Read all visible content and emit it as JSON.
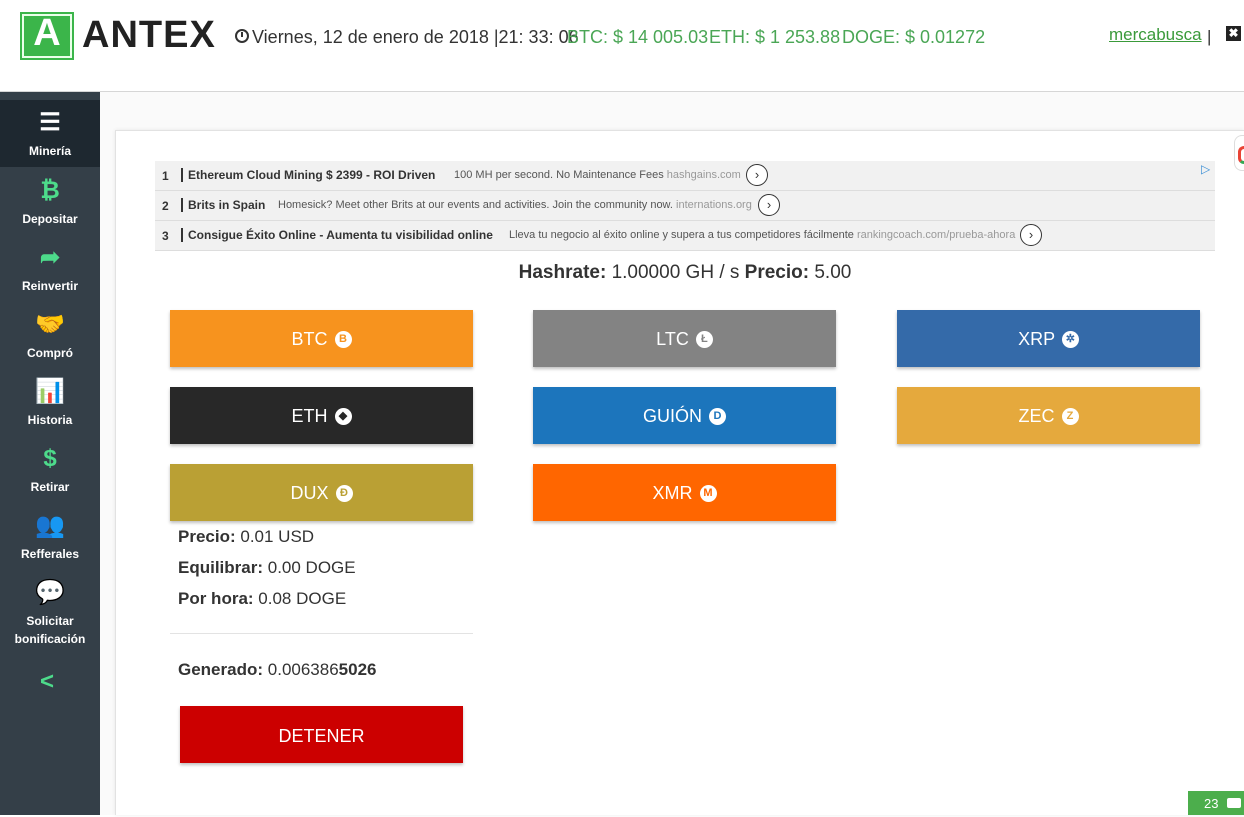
{
  "header": {
    "logo_letter": "A",
    "logo_text": "ANTEX",
    "datetime": "Viernes, 12 de enero de 2018 |21: 33: 06",
    "tickers": [
      {
        "label": "BTC: $ 14 005.03"
      },
      {
        "label": "ETH: $ 1 253.88"
      },
      {
        "label": "DOGE: $ 0.01272"
      }
    ],
    "username": "mercabusca",
    "separator": "|",
    "exit_glyph": "✖"
  },
  "sidebar": {
    "items": [
      {
        "label": "Minería",
        "icon": "list-icon",
        "glyph": "☰"
      },
      {
        "label": "Depositar",
        "icon": "bitcoin-icon",
        "glyph": "₿"
      },
      {
        "label": "Reinvertir",
        "icon": "share-arrow-icon",
        "glyph": "➦"
      },
      {
        "label": "Compró",
        "icon": "handshake-icon",
        "glyph": "🤝"
      },
      {
        "label": "Historia",
        "icon": "bar-chart-icon",
        "glyph": "📊"
      },
      {
        "label": "Retirar",
        "icon": "dollar-icon",
        "glyph": "$"
      },
      {
        "label": "Refferales",
        "icon": "users-icon",
        "glyph": "👥"
      },
      {
        "label": "Solicitar bonificación",
        "icon": "chat-icon",
        "glyph": "💬"
      }
    ],
    "collapse_glyph": "<"
  },
  "ads": {
    "rows": [
      {
        "num": "1",
        "title": "Ethereum Cloud Mining $ 2399 - ROI Driven",
        "desc": "100 MH per second. No Maintenance Fees",
        "domain": "hashgains.com",
        "go": "›"
      },
      {
        "num": "2",
        "title": "Brits in Spain",
        "desc": "Homesick? Meet other Brits at our events and activities. Join the community now.",
        "domain": "internations.org",
        "go": "›"
      },
      {
        "num": "3",
        "title": "Consigue Éxito Online - Aumenta tu visibilidad online",
        "desc": "Lleva tu negocio al éxito online y supera a tus competidores fácilmente",
        "domain": "rankingcoach.com/prueba-ahora",
        "go": "›"
      }
    ],
    "adchoice_glyph": "▷"
  },
  "mining": {
    "hashrate_label": "Hashrate:",
    "hashrate_value": "1.00000 GH / s",
    "price_label": "Precio:",
    "price_value": "5.00"
  },
  "coins": [
    {
      "label": "BTC",
      "glyph": "B",
      "color": "#f7931e"
    },
    {
      "label": "LTC",
      "glyph": "Ł",
      "color": "#838383"
    },
    {
      "label": "XRP",
      "glyph": "✲",
      "color": "#346aa9"
    },
    {
      "label": "ETH",
      "glyph": "◆",
      "color": "#282828"
    },
    {
      "label": "GUIÓN",
      "glyph": "D",
      "color": "#1c75bc"
    },
    {
      "label": "ZEC",
      "glyph": "Z",
      "color": "#e5a93d"
    },
    {
      "label": "DUX",
      "glyph": "Đ",
      "color": "#baa034"
    },
    {
      "label": "XMR",
      "glyph": "M",
      "color": "#ff6600"
    }
  ],
  "stats": {
    "price_label": "Precio:",
    "price_value": "0.01 USD",
    "balance_label": "Equilibrar:",
    "balance_value": "0.00 DOGE",
    "hourly_label": "Por hora:",
    "hourly_value": "0.08 DOGE",
    "generated_label": "Generado:",
    "generated_value_prefix": "0.006386",
    "generated_value_bold": "5026"
  },
  "stop_button": "DETENER",
  "chat": {
    "count": "23"
  }
}
